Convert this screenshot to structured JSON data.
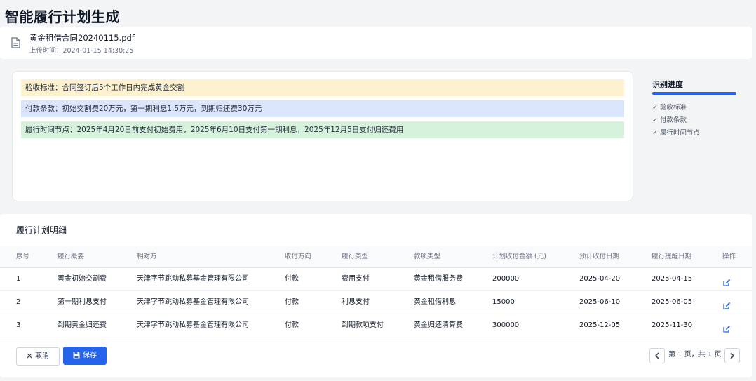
{
  "page": {
    "title": "智能履行计划生成"
  },
  "file": {
    "icon": "document-icon",
    "name": "黄金租借合同20240115.pdf",
    "upload_time": "上传时间：2024-01-15 14:30:25"
  },
  "clauses": [
    {
      "text": "验收标准：合同签订后5个工作日内完成黄金交割",
      "color": "#fdf1cf"
    },
    {
      "text": "付款条款：初始交割费20万元，第一期利息1.5万元，到期归还费30万元",
      "color": "#dbe5fb"
    },
    {
      "text": "履行时间节点：2025年4月20日前支付初始费用，2025年6月10日支付第一期利息，2025年12月5日支付归还费用",
      "color": "#d6f1dc"
    }
  ],
  "progress": {
    "title": "识别进度",
    "value": 1.0,
    "items": [
      "✓ 验收标准",
      "✓ 付款条款",
      "✓ 履行时间节点"
    ]
  },
  "plan": {
    "title": "履行计划明细",
    "columns": [
      "序号",
      "履行概要",
      "相对方",
      "收付方向",
      "履行类型",
      "款项类型",
      "计划收付金额 (元)",
      "预计收付日期",
      "履行提醒日期",
      "操作"
    ],
    "rows": [
      [
        "1",
        "黄金初始交割费",
        "天津字节跳动私募基金管理有限公司",
        "付款",
        "费用支付",
        "黄金租借服务费",
        "200000",
        "2025-04-20",
        "2025-04-15"
      ],
      [
        "2",
        "第一期利息支付",
        "天津字节跳动私募基金管理有限公司",
        "付款",
        "利息支付",
        "黄金租借利息",
        "15000",
        "2025-06-10",
        "2025-06-05"
      ],
      [
        "3",
        "到期黄金归还费",
        "天津字节跳动私募基金管理有限公司",
        "付款",
        "到期款项支付",
        "黄金归还清算费",
        "300000",
        "2025-12-05",
        "2025-11-30"
      ]
    ],
    "row_action_icon": "edit-icon"
  },
  "actions": {
    "cancel": "取消",
    "save": "保存"
  },
  "pagination": {
    "text": "第 1 页，共 1 页"
  },
  "colors": {
    "accent": "#2563eb"
  }
}
